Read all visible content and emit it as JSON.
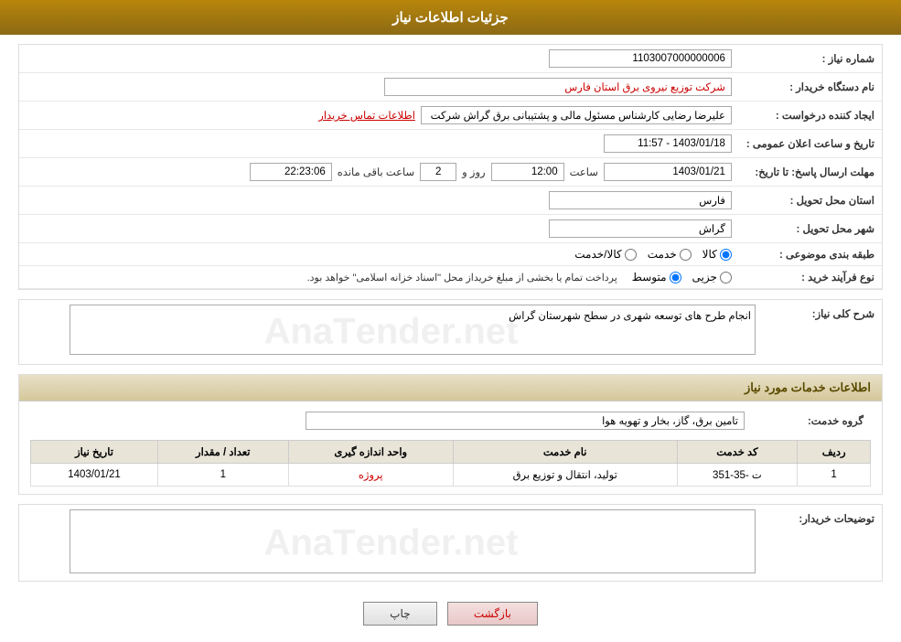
{
  "header": {
    "title": "جزئیات اطلاعات نیاز"
  },
  "fields": {
    "need_number_label": "شماره نیاز :",
    "need_number_value": "1103007000000006",
    "buyer_org_label": "نام دستگاه خریدار :",
    "buyer_org_value": "شرکت توزیع نیروی برق استان فارس",
    "requester_label": "ایجاد کننده درخواست :",
    "requester_value": "علیرضا رضایی کارشناس مسئول مالی و پشتیبانی برق گراش شرکت توزیع نیروه",
    "contact_link": "اطلاعات تماس خریدار",
    "announce_datetime_label": "تاریخ و ساعت اعلان عمومی :",
    "announce_datetime_value": "1403/01/18 - 11:57",
    "deadline_label": "مهلت ارسال پاسخ: تا تاریخ:",
    "deadline_date": "1403/01/21",
    "deadline_time_label": "ساعت",
    "deadline_time": "12:00",
    "deadline_day_label": "روز و",
    "deadline_days": "2",
    "deadline_remain_label": "ساعت باقی مانده",
    "deadline_remain": "22:23:06",
    "province_label": "استان محل تحویل :",
    "province_value": "فارس",
    "city_label": "شهر محل تحویل :",
    "city_value": "گراش",
    "category_label": "طبقه بندی موضوعی :",
    "category_options": [
      "کالا",
      "خدمت",
      "کالا/خدمت"
    ],
    "category_selected": "کالا",
    "process_label": "نوع فرآیند خرید :",
    "process_options": [
      "جزیی",
      "متوسط"
    ],
    "process_note": "پرداخت تمام یا بخشی از مبلغ خریداز محل \"اسناد خزانه اسلامی\" خواهد بود.",
    "general_desc_label": "شرح کلی نیاز:",
    "general_desc_value": "انجام طرح های توسعه شهری در سطح شهرستان گراش",
    "services_section_title": "اطلاعات خدمات مورد نیاز",
    "service_group_label": "گروه خدمت:",
    "service_group_value": "تامین برق، گاز، بخار و تهویه هوا",
    "table_headers": [
      "ردیف",
      "کد خدمت",
      "نام خدمت",
      "واحد اندازه گیری",
      "تعداد / مقدار",
      "تاریخ نیاز"
    ],
    "table_rows": [
      {
        "row": "1",
        "code": "ت -35-351",
        "name": "تولید، انتقال و توزیع برق",
        "unit": "پروژه",
        "quantity": "1",
        "date": "1403/01/21"
      }
    ],
    "buyer_desc_label": "توضیحات خریدار:",
    "buyer_desc_value": ""
  },
  "buttons": {
    "print": "چاپ",
    "back": "بازگشت"
  }
}
